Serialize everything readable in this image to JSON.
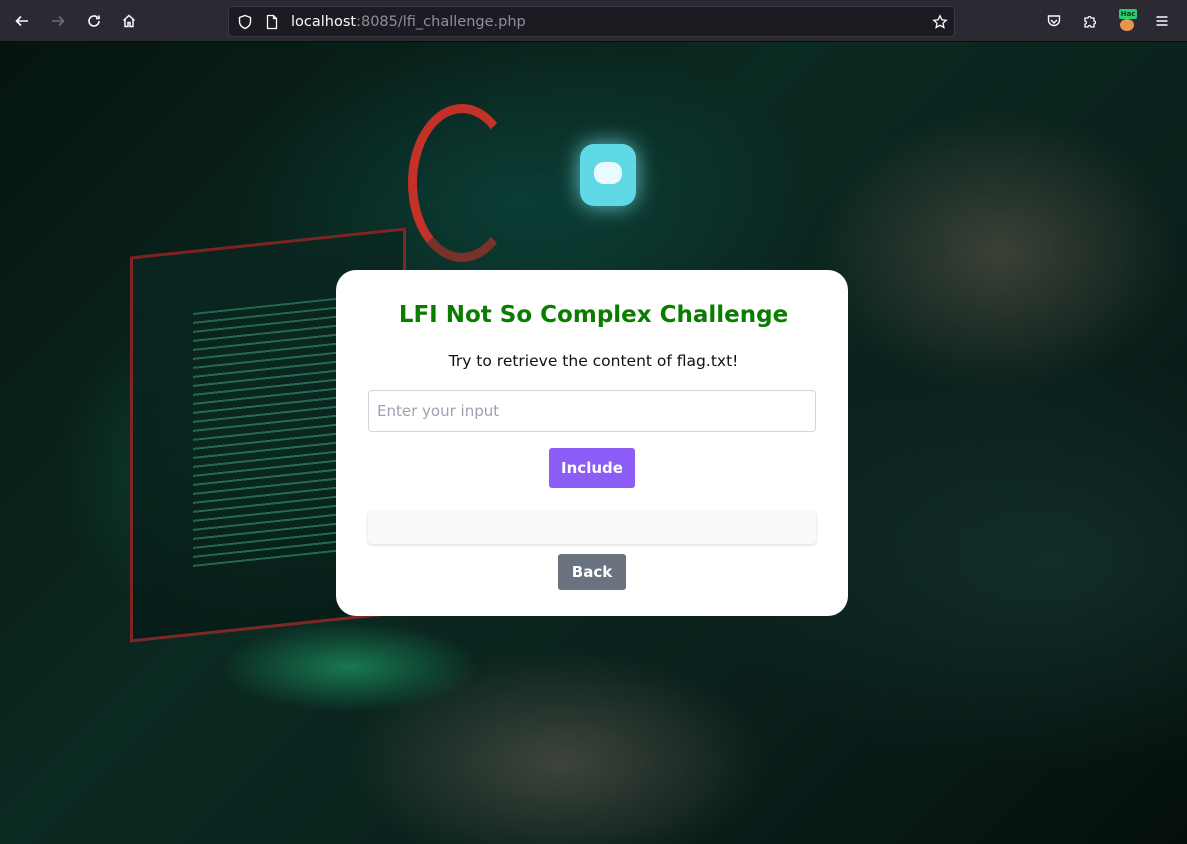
{
  "browser": {
    "url_host": "localhost",
    "url_rest": ":8085/lfi_challenge.php",
    "extension_badge": "Hac"
  },
  "challenge": {
    "title": "LFI Not So Complex Challenge",
    "subtitle": "Try to retrieve the content of flag.txt!",
    "input_placeholder": "Enter your input",
    "input_value": "",
    "include_label": "Include",
    "result_text": "",
    "back_label": "Back"
  },
  "colors": {
    "title": "#0a7d00",
    "include_button": "#8b5cf6",
    "back_button": "#6b7280"
  }
}
